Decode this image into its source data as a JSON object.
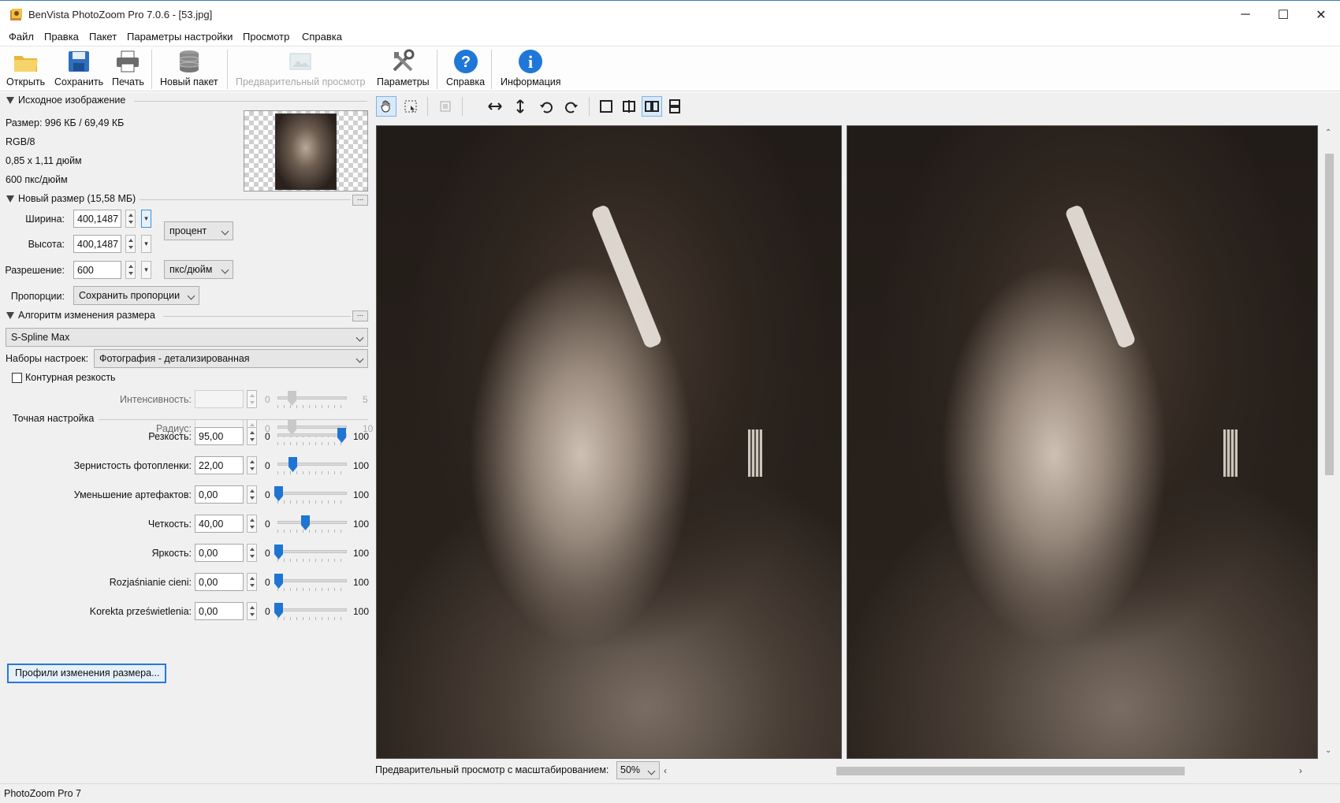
{
  "window": {
    "title": "BenVista PhotoZoom Pro 7.0.6 - [53.jpg]",
    "controls": [
      "─",
      "☐",
      "✕"
    ]
  },
  "menu": [
    "Файл",
    "Правка",
    "Пакет",
    "Параметры настройки",
    "Просмотр",
    "Справка"
  ],
  "toolbar": {
    "open": "Открыть",
    "save": "Сохранить",
    "print": "Печать",
    "new_batch": "Новый пакет",
    "preview": "Предварительный просмотр",
    "params": "Параметры",
    "help": "Справка",
    "info": "Информация"
  },
  "source": {
    "header": "Исходное изображение",
    "size": "Размер: 996 КБ / 69,49 КБ",
    "mode": "RGB/8",
    "dims": "0,85 x 1,11 дюйм",
    "res": "600 пкс/дюйм"
  },
  "new_size": {
    "header": "Новый размер (15,58 МБ)",
    "width_label": "Ширина:",
    "width_value": "400,1487",
    "height_label": "Высота:",
    "height_value": "400,1487",
    "unit": "процент",
    "res_label": "Разрешение:",
    "res_value": "600",
    "res_unit": "пкс/дюйм",
    "proportions_label": "Пропорции:",
    "proportions_value": "Сохранить пропорции"
  },
  "algorithm": {
    "header": "Алгоритм изменения размера",
    "value": "S-Spline Max",
    "presets_label": "Наборы настроек:",
    "presets_value": "Фотография - детализированная"
  },
  "sharpening": {
    "checkbox_label": "Контурная резкость",
    "checked": false,
    "sliders": [
      {
        "label": "Интенсивность:",
        "value": "",
        "min": "0",
        "max": "5",
        "level": 0.2
      },
      {
        "label": "Радиус:",
        "value": "",
        "min": "0",
        "max": "10",
        "level": 0.2
      }
    ]
  },
  "fine_tune": {
    "header": "Точная настройка",
    "sliders": [
      {
        "label": "Резкость:",
        "value": "95,00",
        "min": "0",
        "max": "100",
        "level": 0.95
      },
      {
        "label": "Зернистость фотопленки:",
        "value": "22,00",
        "min": "0",
        "max": "100",
        "level": 0.22
      },
      {
        "label": "Уменьшение артефактов:",
        "value": "0,00",
        "min": "0",
        "max": "100",
        "level": 0.0
      },
      {
        "label": "Четкость:",
        "value": "40,00",
        "min": "0",
        "max": "100",
        "level": 0.4
      },
      {
        "label": "Яркость:",
        "value": "0,00",
        "min": "0",
        "max": "100",
        "level": 0.0
      },
      {
        "label": "Rozjaśnianie cieni:",
        "value": "0,00",
        "min": "0",
        "max": "100",
        "level": 0.0
      },
      {
        "label": "Korekta prześwietlenia:",
        "value": "0,00",
        "min": "0",
        "max": "100",
        "level": 0.0
      }
    ]
  },
  "profile_button": "Профили изменения размера...",
  "preview": {
    "zoom_label": "Предварительный просмотр с масштабированием:",
    "zoom_value": "50%"
  },
  "status": "PhotoZoom Pro 7",
  "colors": {
    "accent": "#1f75d3"
  }
}
